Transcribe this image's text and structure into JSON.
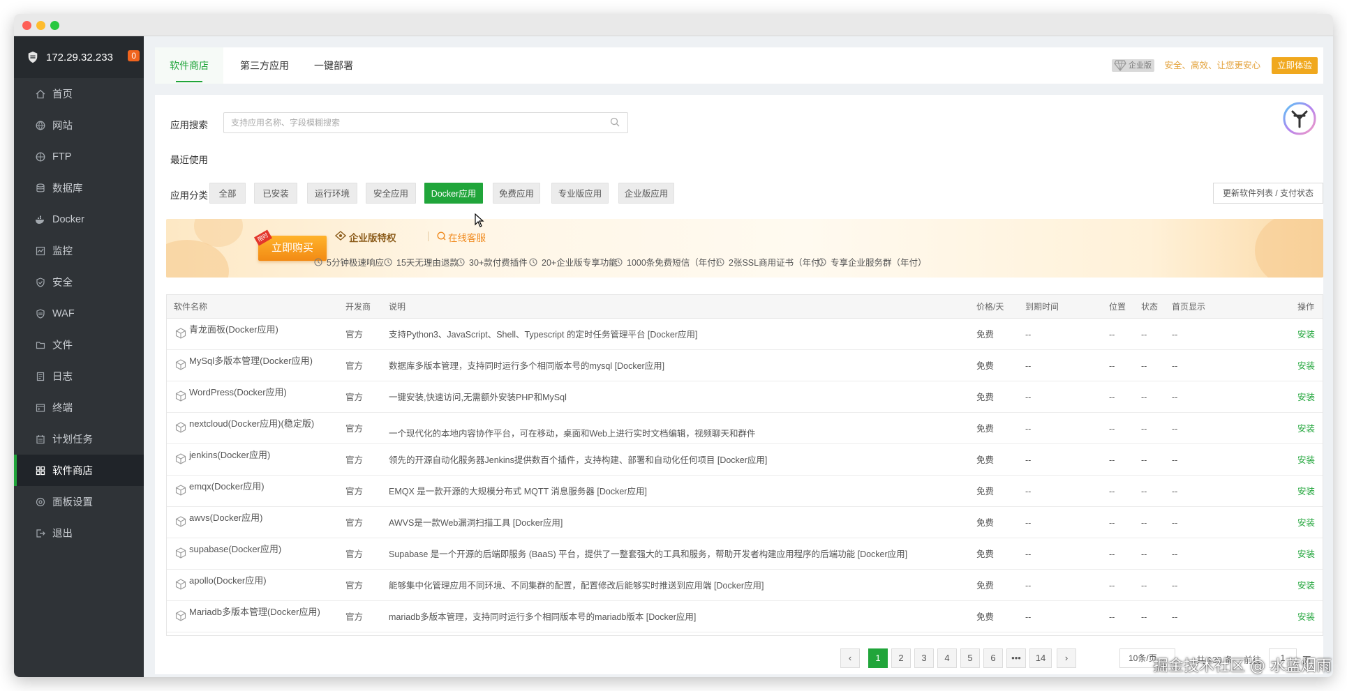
{
  "sidebar": {
    "host": "172.29.32.233",
    "badge": "0",
    "items": [
      {
        "label": "首页",
        "icon": "home-icon"
      },
      {
        "label": "网站",
        "icon": "globe-icon"
      },
      {
        "label": "FTP",
        "icon": "ftp-icon"
      },
      {
        "label": "数据库",
        "icon": "database-icon"
      },
      {
        "label": "Docker",
        "icon": "docker-icon"
      },
      {
        "label": "监控",
        "icon": "monitor-icon"
      },
      {
        "label": "安全",
        "icon": "shield-check-icon"
      },
      {
        "label": "WAF",
        "icon": "waf-shield-icon"
      },
      {
        "label": "文件",
        "icon": "folder-icon"
      },
      {
        "label": "日志",
        "icon": "log-icon"
      },
      {
        "label": "终端",
        "icon": "terminal-icon"
      },
      {
        "label": "计划任务",
        "icon": "calendar-icon"
      },
      {
        "label": "软件商店",
        "icon": "grid-icon"
      },
      {
        "label": "面板设置",
        "icon": "settings-icon"
      },
      {
        "label": "退出",
        "icon": "logout-icon"
      }
    ],
    "active_index": 12
  },
  "tabs": {
    "items": [
      "软件商店",
      "第三方应用",
      "一键部署"
    ],
    "enterprise_badge": "企业版",
    "enterprise_text": "安全、高效、让您更安心",
    "try_label": "立即体验"
  },
  "search": {
    "label": "应用搜索",
    "placeholder": "支持应用名称、字段模糊搜索"
  },
  "recent_label": "最近使用",
  "categories": {
    "label": "应用分类",
    "items": [
      "全部",
      "已安装",
      "运行环境",
      "安全应用",
      "Docker应用",
      "免费应用",
      "专业版应用",
      "企业版应用"
    ],
    "active": "Docker应用",
    "update_label": "更新软件列表 / 支付状态"
  },
  "banner": {
    "buy_label": "立即购买",
    "buy_tag": "限时",
    "title": "企业版特权",
    "online": "在线客服",
    "features": [
      "5分钟极速响应",
      "15天无理由退款",
      "30+款付费插件",
      "20+企业版专享功能",
      "1000条免费短信（年付）",
      "2张SSL商用证书（年付）",
      "专享企业服务群（年付）"
    ]
  },
  "table": {
    "headers": {
      "name": "软件名称",
      "dev": "开发商",
      "desc": "说明",
      "price": "价格/天",
      "expire": "到期时间",
      "pos": "位置",
      "status": "状态",
      "home": "首页显示",
      "op": "操作"
    },
    "rows": [
      {
        "name": "青龙面板(Docker应用)",
        "dev": "官方",
        "desc": "支持Python3、JavaScript、Shell、Typescript 的定时任务管理平台 [Docker应用]",
        "price": "免费",
        "expire": "--",
        "pos": "--",
        "status": "--",
        "home": "--",
        "op": "安装"
      },
      {
        "name": "MySql多版本管理(Docker应用)",
        "dev": "官方",
        "desc": "数据库多版本管理，支持同时运行多个相同版本号的mysql [Docker应用]",
        "price": "免费",
        "expire": "--",
        "pos": "--",
        "status": "--",
        "home": "--",
        "op": "安装"
      },
      {
        "name": "WordPress(Docker应用)",
        "dev": "官方",
        "desc": "一键安装,快速访问,无需额外安装PHP和MySql",
        "price": "免费",
        "expire": "--",
        "pos": "--",
        "status": "--",
        "home": "--",
        "op": "安装"
      },
      {
        "name": "nextcloud(Docker应用)(稳定版)",
        "dev": "官方",
        "desc": "一个现代化的本地内容协作平台，可在移动，桌面和Web上进行实时文档编辑，视频聊天和群件",
        "price": "免费",
        "expire": "--",
        "pos": "--",
        "status": "--",
        "home": "--",
        "op": "安装"
      },
      {
        "name": "jenkins(Docker应用)",
        "dev": "官方",
        "desc": "领先的开源自动化服务器Jenkins提供数百个插件，支持构建、部署和自动化任何项目 [Docker应用]",
        "price": "免费",
        "expire": "--",
        "pos": "--",
        "status": "--",
        "home": "--",
        "op": "安装"
      },
      {
        "name": "emqx(Docker应用)",
        "dev": "官方",
        "desc": "EMQX 是一款开源的大规模分布式 MQTT 消息服务器 [Docker应用]",
        "price": "免费",
        "expire": "--",
        "pos": "--",
        "status": "--",
        "home": "--",
        "op": "安装"
      },
      {
        "name": "awvs(Docker应用)",
        "dev": "官方",
        "desc": "AWVS是一款Web漏洞扫描工具 [Docker应用]",
        "price": "免费",
        "expire": "--",
        "pos": "--",
        "status": "--",
        "home": "--",
        "op": "安装"
      },
      {
        "name": "supabase(Docker应用)",
        "dev": "官方",
        "desc": "Supabase 是一个开源的后端即服务 (BaaS) 平台，提供了一整套强大的工具和服务，帮助开发者构建应用程序的后端功能 [Docker应用]",
        "price": "免费",
        "expire": "--",
        "pos": "--",
        "status": "--",
        "home": "--",
        "op": "安装"
      },
      {
        "name": "apollo(Docker应用)",
        "dev": "官方",
        "desc": "能够集中化管理应用不同环境、不同集群的配置，配置修改后能够实时推送到应用端 [Docker应用]",
        "price": "免费",
        "expire": "--",
        "pos": "--",
        "status": "--",
        "home": "--",
        "op": "安装"
      },
      {
        "name": "Mariadb多版本管理(Docker应用)",
        "dev": "官方",
        "desc": "mariadb多版本管理，支持同时运行多个相同版本号的mariadb版本 [Docker应用]",
        "price": "免费",
        "expire": "--",
        "pos": "--",
        "status": "--",
        "home": "--",
        "op": "安装"
      }
    ]
  },
  "pager": {
    "prev": "‹",
    "pages": [
      "1",
      "2",
      "3",
      "4",
      "5",
      "6",
      "•••",
      "14"
    ],
    "next": "›",
    "size": "10条/页",
    "total": "共 139 条",
    "goto": "前往",
    "page_input": "1",
    "page_unit": "页"
  },
  "watermark": "掘金技术社区 @ 水蓝烟雨"
}
